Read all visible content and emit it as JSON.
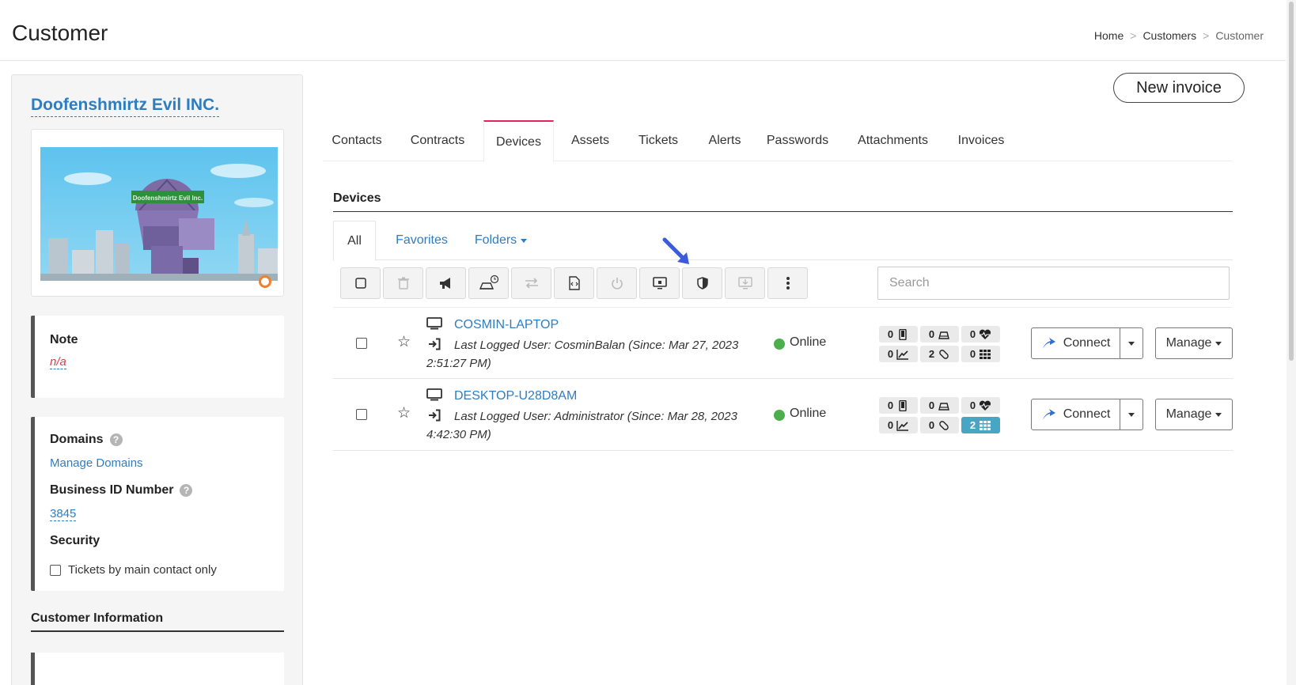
{
  "header": {
    "title": "Customer",
    "breadcrumb": [
      {
        "label": "Home"
      },
      {
        "label": "Customers"
      },
      {
        "label": "Customer"
      }
    ]
  },
  "customer": {
    "name": "Doofenshmirtz Evil INC.",
    "logo_sign_text": "Doofenshmirtz Evil Inc."
  },
  "note": {
    "title": "Note",
    "value": "n/a"
  },
  "info": {
    "domains_label": "Domains",
    "manage_domains_link": "Manage Domains",
    "business_id_label": "Business ID Number",
    "business_id_value": "3845",
    "security_label": "Security",
    "tickets_checkbox_label": "Tickets by main contact only",
    "tickets_checkbox_checked": false
  },
  "customer_information_title": "Customer Information",
  "new_invoice_label": "New invoice",
  "tabs": [
    {
      "label": "Contacts",
      "active": false
    },
    {
      "label": "Contracts",
      "active": false
    },
    {
      "label": "Devices",
      "active": true
    },
    {
      "label": "Assets",
      "active": false
    },
    {
      "label": "Tickets",
      "active": false
    },
    {
      "label": "Alerts",
      "active": false
    },
    {
      "label": "Passwords",
      "active": false
    },
    {
      "label": "Attachments",
      "active": false
    },
    {
      "label": "Invoices",
      "active": false
    }
  ],
  "devices_section": {
    "title": "Devices",
    "subtabs": [
      {
        "label": "All",
        "active": true
      },
      {
        "label": "Favorites",
        "active": false
      },
      {
        "label": "Folders",
        "active": false
      }
    ],
    "toolbar_icons": [
      "checkbox-icon",
      "trash-icon",
      "megaphone-icon",
      "drive-clock-icon",
      "transfer-icon",
      "script-icon",
      "power-icon",
      "monitor-icon",
      "shield-icon",
      "monitor-download-icon",
      "more-vertical-icon"
    ],
    "search": {
      "placeholder": "Search",
      "value": ""
    },
    "connect_label": "Connect",
    "manage_label": "Manage",
    "status_color": "#4cae4c",
    "accent_tab_color": "#e2235d",
    "link_color": "#2f7dc1"
  },
  "devices": [
    {
      "name": "COSMIN-LAPTOP",
      "last_logged": "Last Logged User: CosminBalan (Since: Mar 27, 2023 2:51:27 PM)",
      "status": "Online",
      "badges": {
        "mobile": "0",
        "drive": "0",
        "health": "0",
        "chart": "0",
        "patch": "2",
        "apps": "0"
      },
      "apps_highlight": false
    },
    {
      "name": "DESKTOP-U28D8AM",
      "last_logged": "Last Logged User: Administrator (Since: Mar 28, 2023 4:42:30 PM)",
      "status": "Online",
      "badges": {
        "mobile": "0",
        "drive": "0",
        "health": "0",
        "chart": "0",
        "patch": "0",
        "apps": "2"
      },
      "apps_highlight": true
    }
  ]
}
